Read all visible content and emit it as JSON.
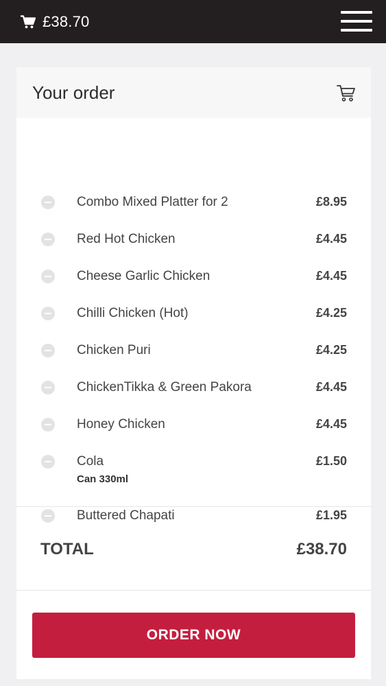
{
  "header": {
    "cart_total": "£38.70",
    "cart_icon": "cart-icon",
    "menu_icon": "hamburger-menu-icon"
  },
  "order": {
    "title": "Your order",
    "items": [
      {
        "name": "Combo Mixed Platter for 2",
        "price": "£8.95"
      },
      {
        "name": "Red Hot Chicken",
        "price": "£4.45"
      },
      {
        "name": "Cheese Garlic Chicken",
        "price": "£4.45"
      },
      {
        "name": "Chilli Chicken (Hot)",
        "price": "£4.25"
      },
      {
        "name": "Chicken Puri",
        "price": "£4.25"
      },
      {
        "name": "ChickenTikka & Green Pakora",
        "price": "£4.45"
      },
      {
        "name": "Honey Chicken",
        "price": "£4.45"
      },
      {
        "name": "Cola",
        "price": "£1.50",
        "option": "Can 330ml"
      },
      {
        "name": "Buttered Chapati",
        "price": "£1.95"
      }
    ],
    "total_label": "TOTAL",
    "total_value": "£38.70",
    "order_button": "ORDER NOW"
  },
  "colors": {
    "header_bg": "#231f20",
    "accent": "#c41e3f"
  }
}
